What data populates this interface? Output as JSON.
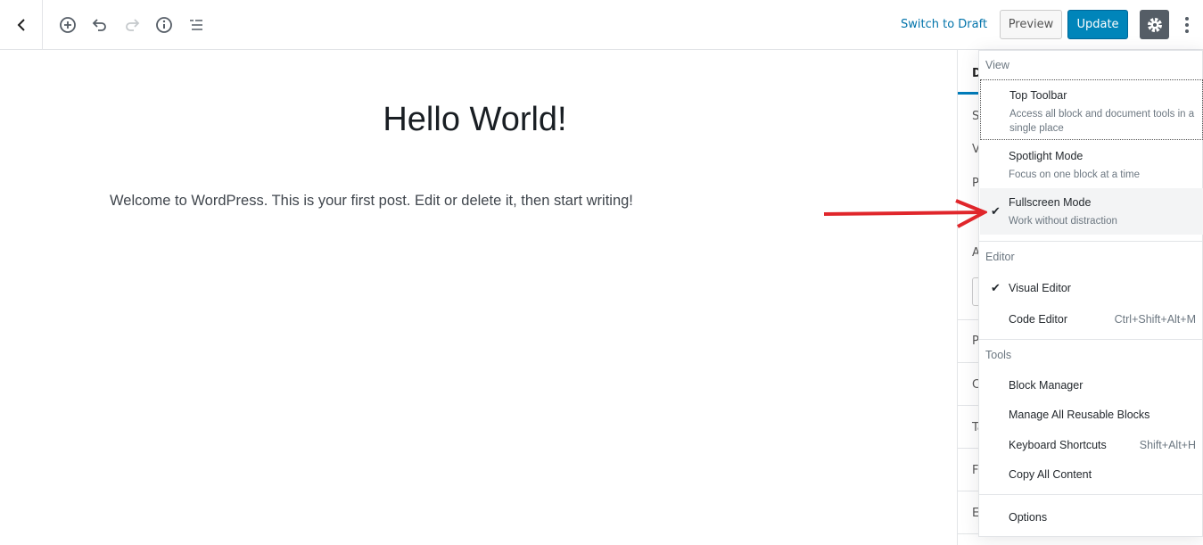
{
  "toolbar": {
    "switch_draft": "Switch to Draft",
    "preview": "Preview",
    "update": "Update"
  },
  "post": {
    "title": "Hello World!",
    "paragraph": "Welcome to WordPress. This is your first post. Edit or delete it, then start writing!"
  },
  "sidebar": {
    "tab": "D",
    "letters": [
      "S",
      "V",
      "P",
      "A",
      "P",
      "C",
      "Ta",
      "Fe",
      "Ex"
    ]
  },
  "menu": {
    "view_label": "View",
    "view": [
      {
        "label": "Top Toolbar",
        "desc": "Access all block and document tools in a single place",
        "checked": false
      },
      {
        "label": "Spotlight Mode",
        "desc": "Focus on one block at a time",
        "checked": false
      },
      {
        "label": "Fullscreen Mode",
        "desc": "Work without distraction",
        "checked": true
      }
    ],
    "editor_label": "Editor",
    "editor": [
      {
        "label": "Visual Editor",
        "shortcut": "",
        "checked": true
      },
      {
        "label": "Code Editor",
        "shortcut": "Ctrl+Shift+Alt+M",
        "checked": false
      }
    ],
    "tools_label": "Tools",
    "tools": [
      {
        "label": "Block Manager",
        "shortcut": ""
      },
      {
        "label": "Manage All Reusable Blocks",
        "shortcut": ""
      },
      {
        "label": "Keyboard Shortcuts",
        "shortcut": "Shift+Alt+H"
      },
      {
        "label": "Copy All Content",
        "shortcut": ""
      }
    ],
    "options": "Options",
    "check_glyph": "✔"
  },
  "colors": {
    "accent": "#0085ba",
    "annotation_arrow": "#e0262b"
  }
}
